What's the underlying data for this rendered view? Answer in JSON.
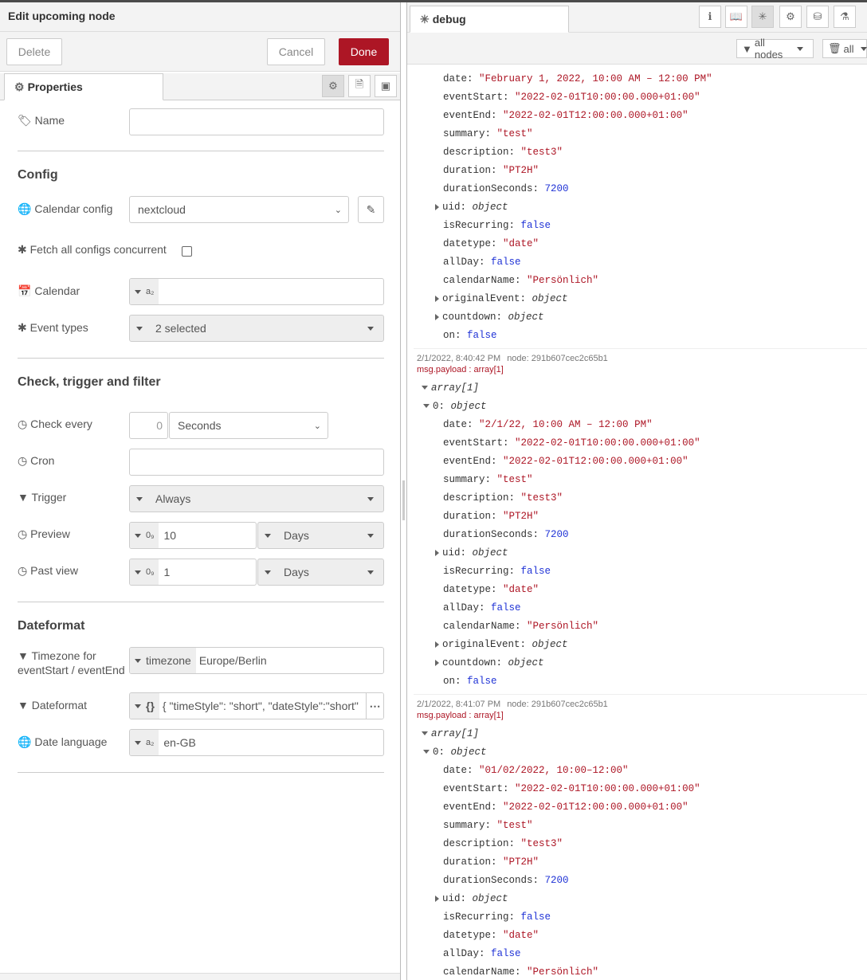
{
  "tray": {
    "title": "Edit upcoming node",
    "delete_label": "Delete",
    "cancel_label": "Cancel",
    "done_label": "Done",
    "tab_properties": "Properties"
  },
  "form": {
    "name_label": "Name",
    "name_value": "",
    "config_heading": "Config",
    "calendar_config_label": "Calendar config",
    "calendar_config_value": "nextcloud",
    "fetch_all_label": "Fetch all configs concurrent",
    "calendar_label": "Calendar",
    "calendar_value": "",
    "event_types_label": "Event types",
    "event_types_value": "2 selected",
    "check_heading": "Check, trigger and filter",
    "check_every_label": "Check every",
    "check_every_value": "0",
    "check_every_unit": "Seconds",
    "cron_label": "Cron",
    "cron_value": "",
    "trigger_label": "Trigger",
    "trigger_value": "Always",
    "preview_label": "Preview",
    "preview_value": "10",
    "preview_unit": "Days",
    "pastview_label": "Past view",
    "pastview_value": "1",
    "pastview_unit": "Days",
    "dateformat_heading": "Dateformat",
    "timezone_label_1": "Timezone for",
    "timezone_label_2": "eventStart / eventEnd",
    "timezone_type": "timezone",
    "timezone_value": "Europe/Berlin",
    "dateformat_label": "Dateformat",
    "dateformat_type": "{}",
    "dateformat_value": "{ \"timeStyle\": \"short\", \"dateStyle\":\"short\" }",
    "date_language_label": "Date language",
    "date_language_value": "en-GB",
    "str_type": "a₂",
    "num_type": "0₉"
  },
  "debug": {
    "tab_label": "debug",
    "filter_nodes": "all nodes",
    "filter_all": "all",
    "messages": [
      {
        "meta": "",
        "node": "",
        "topic": "",
        "date": "\"February 1, 2022, 10:00 AM – 12:00 PM\""
      },
      {
        "meta": "2/1/2022, 8:40:42 PM",
        "node": "node: 291b607cec2c65b1",
        "topic": "msg.payload : array[1]",
        "date": "\"2/1/22, 10:00 AM – 12:00 PM\""
      },
      {
        "meta": "2/1/2022, 8:41:07 PM",
        "node": "node: 291b607cec2c65b1",
        "topic": "msg.payload : array[1]",
        "date": "\"01/02/2022, 10:00–12:00\""
      }
    ],
    "fields": {
      "date_k": "date:",
      "eventStart_k": "eventStart:",
      "eventStart_v": "\"2022-02-01T10:00:00.000+01:00\"",
      "eventEnd_k": "eventEnd:",
      "eventEnd_v": "\"2022-02-01T12:00:00.000+01:00\"",
      "summary_k": "summary:",
      "summary_v": "\"test\"",
      "description_k": "description:",
      "description_v": "\"test3\"",
      "duration_k": "duration:",
      "duration_v": "\"PT2H\"",
      "durationSeconds_k": "durationSeconds:",
      "durationSeconds_v": "7200",
      "uid_k": "uid:",
      "object_v": "object",
      "isRecurring_k": "isRecurring:",
      "false_v": "false",
      "datetype_k": "datetype:",
      "datetype_v": "\"date\"",
      "allDay_k": "allDay:",
      "calendarName_k": "calendarName:",
      "calendarName_v": "\"Persönlich\"",
      "originalEvent_k": "originalEvent:",
      "countdown_k": "countdown:",
      "on_k": "on:",
      "array_v": "array[1]",
      "zero_k": "0:"
    }
  }
}
